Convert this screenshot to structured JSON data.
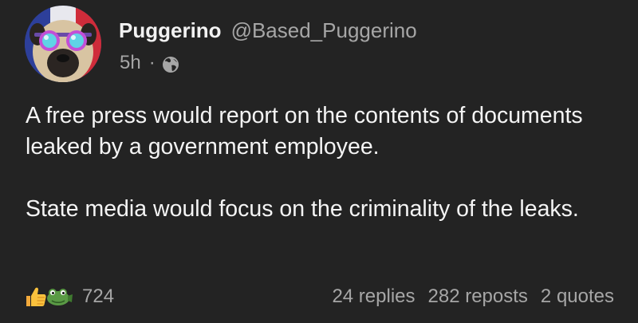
{
  "post": {
    "author": {
      "display_name": "Puggerino",
      "handle": "@Based_Puggerino",
      "avatar_icon": "pug-with-sunglasses-avatar"
    },
    "time_ago": "5h",
    "separator": "·",
    "visibility_icon": "globe-icon",
    "body": {
      "paragraph_1": "A free press would report on the contents of documents leaked by a government employee.",
      "paragraph_2": "State media would focus on the criminality of the leaks."
    },
    "reactions": {
      "icons": [
        "thumbs-up-icon",
        "frog-emoji-icon"
      ],
      "count": "724"
    },
    "stats": {
      "replies": "24 replies",
      "reposts": "282 reposts",
      "quotes": "2 quotes"
    }
  },
  "colors": {
    "background": "#232323",
    "text_primary": "#f4f4f4",
    "text_secondary": "#a6a6a6"
  }
}
